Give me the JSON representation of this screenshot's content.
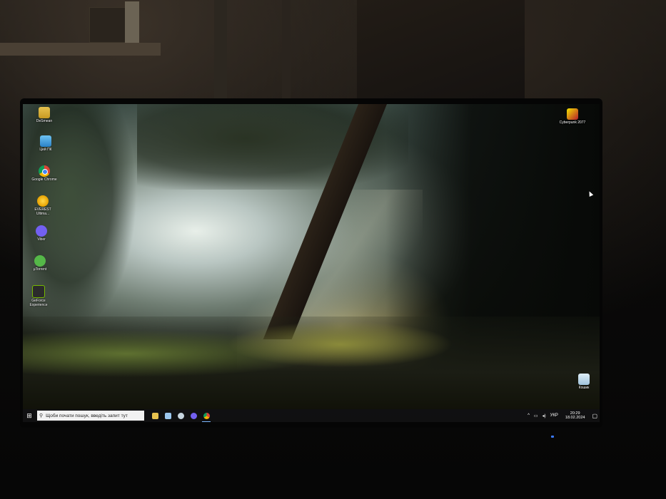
{
  "desktop": {
    "icons": [
      {
        "label": "DeSmean",
        "icon": "folder-icon",
        "color": "#e7c24f"
      },
      {
        "label": "Цей ПК",
        "icon": "this-pc-icon",
        "color": "#2a82c8"
      },
      {
        "label": "Google Chrome",
        "icon": "chrome-icon",
        "color": "#4285f4"
      },
      {
        "label": "EVEREST Ultima...",
        "icon": "everest-icon",
        "color": "#e6a100"
      },
      {
        "label": "Viber",
        "icon": "viber-icon",
        "color": "#7360f2"
      },
      {
        "label": "µTorrent",
        "icon": "utorrent-icon",
        "color": "#55b848"
      },
      {
        "label": "GeForce Experience",
        "icon": "geforce-icon",
        "color": "#76b900"
      }
    ],
    "right_icons": [
      {
        "label": "Cyberpunk 2077",
        "icon": "cyberpunk-icon",
        "color": "#f3e600"
      },
      {
        "label": "Кошик",
        "icon": "recycle-bin-icon",
        "color": "#9fc3dc"
      }
    ]
  },
  "taskbar": {
    "start_glyph": "⊞",
    "search_glyph": "⚲",
    "search_placeholder": "Щоби почати пошук, введіть запит тут",
    "pinned": [
      {
        "name": "file-explorer",
        "icon": "folder-icon",
        "color": "#e7c24f"
      },
      {
        "name": "notepad",
        "icon": "notepad-icon",
        "color": "#9cc7ef"
      },
      {
        "name": "steam",
        "icon": "steam-icon",
        "color": "#c7d5e0"
      },
      {
        "name": "viber",
        "icon": "viber-icon",
        "color": "#7360f2"
      },
      {
        "name": "chrome",
        "icon": "chrome-icon",
        "color": "#4285f4"
      }
    ],
    "tray": {
      "chevron": "^",
      "network": "▭",
      "volume": "◂)",
      "language": "УКР",
      "time": "20:29",
      "date": "18.02.2024",
      "notification_glyph": "▢"
    }
  }
}
